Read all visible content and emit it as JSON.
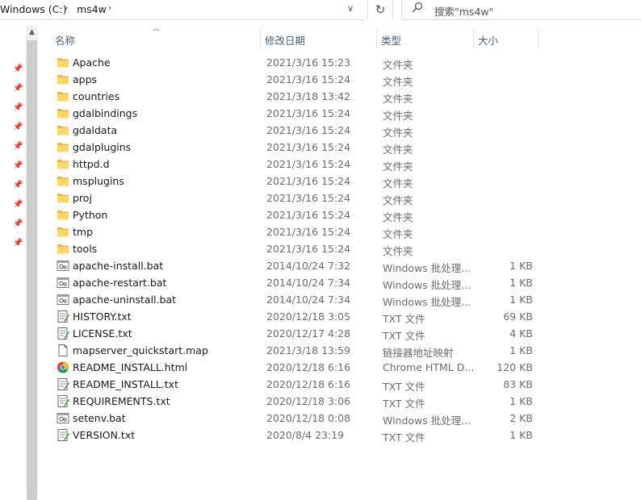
{
  "address": {
    "crumbs": [
      "Windows (C:)",
      "ms4w"
    ],
    "search_placeholder": "搜索\"ms4w\""
  },
  "columns": {
    "name": "名称",
    "date": "修改日期",
    "type": "类型",
    "size": "大小"
  },
  "files": [
    {
      "name": "Apache",
      "date": "2021/3/16 15:23",
      "type": "文件夹",
      "size": "",
      "icon": "folder-icon"
    },
    {
      "name": "apps",
      "date": "2021/3/16 15:24",
      "type": "文件夹",
      "size": "",
      "icon": "folder-icon"
    },
    {
      "name": "countries",
      "date": "2021/3/18 13:42",
      "type": "文件夹",
      "size": "",
      "icon": "folder-icon"
    },
    {
      "name": "gdalbindings",
      "date": "2021/3/16 15:24",
      "type": "文件夹",
      "size": "",
      "icon": "folder-icon"
    },
    {
      "name": "gdaldata",
      "date": "2021/3/16 15:24",
      "type": "文件夹",
      "size": "",
      "icon": "folder-icon"
    },
    {
      "name": "gdalplugins",
      "date": "2021/3/16 15:24",
      "type": "文件夹",
      "size": "",
      "icon": "folder-icon"
    },
    {
      "name": "httpd.d",
      "date": "2021/3/16 15:24",
      "type": "文件夹",
      "size": "",
      "icon": "folder-icon"
    },
    {
      "name": "msplugins",
      "date": "2021/3/16 15:24",
      "type": "文件夹",
      "size": "",
      "icon": "folder-icon"
    },
    {
      "name": "proj",
      "date": "2021/3/16 15:24",
      "type": "文件夹",
      "size": "",
      "icon": "folder-icon"
    },
    {
      "name": "Python",
      "date": "2021/3/16 15:24",
      "type": "文件夹",
      "size": "",
      "icon": "folder-icon"
    },
    {
      "name": "tmp",
      "date": "2021/3/16 15:24",
      "type": "文件夹",
      "size": "",
      "icon": "folder-icon"
    },
    {
      "name": "tools",
      "date": "2021/3/16 15:24",
      "type": "文件夹",
      "size": "",
      "icon": "folder-icon"
    },
    {
      "name": "apache-install.bat",
      "date": "2014/10/24 7:32",
      "type": "Windows 批处理...",
      "size": "1 KB",
      "icon": "batch-file-icon"
    },
    {
      "name": "apache-restart.bat",
      "date": "2014/10/24 7:34",
      "type": "Windows 批处理...",
      "size": "1 KB",
      "icon": "batch-file-icon"
    },
    {
      "name": "apache-uninstall.bat",
      "date": "2014/10/24 7:34",
      "type": "Windows 批处理...",
      "size": "1 KB",
      "icon": "batch-file-icon"
    },
    {
      "name": "HISTORY.txt",
      "date": "2020/12/18 3:05",
      "type": "TXT 文件",
      "size": "69 KB",
      "icon": "text-file-icon"
    },
    {
      "name": "LICENSE.txt",
      "date": "2020/12/17 4:28",
      "type": "TXT 文件",
      "size": "4 KB",
      "icon": "text-file-icon"
    },
    {
      "name": "mapserver_quickstart.map",
      "date": "2021/3/18 13:59",
      "type": "链接器地址映射",
      "size": "1 KB",
      "icon": "map-file-icon"
    },
    {
      "name": "README_INSTALL.html",
      "date": "2020/12/18 6:16",
      "type": "Chrome HTML D...",
      "size": "120 KB",
      "icon": "chrome-html-icon"
    },
    {
      "name": "README_INSTALL.txt",
      "date": "2020/12/18 6:16",
      "type": "TXT 文件",
      "size": "83 KB",
      "icon": "text-file-icon"
    },
    {
      "name": "REQUIREMENTS.txt",
      "date": "2020/12/18 3:06",
      "type": "TXT 文件",
      "size": "1 KB",
      "icon": "text-file-icon"
    },
    {
      "name": "setenv.bat",
      "date": "2020/12/18 0:08",
      "type": "Windows 批处理...",
      "size": "2 KB",
      "icon": "batch-file-icon"
    },
    {
      "name": "VERSION.txt",
      "date": "2020/8/4 23:19",
      "type": "TXT 文件",
      "size": "1 KB",
      "icon": "text-file-icon"
    }
  ]
}
